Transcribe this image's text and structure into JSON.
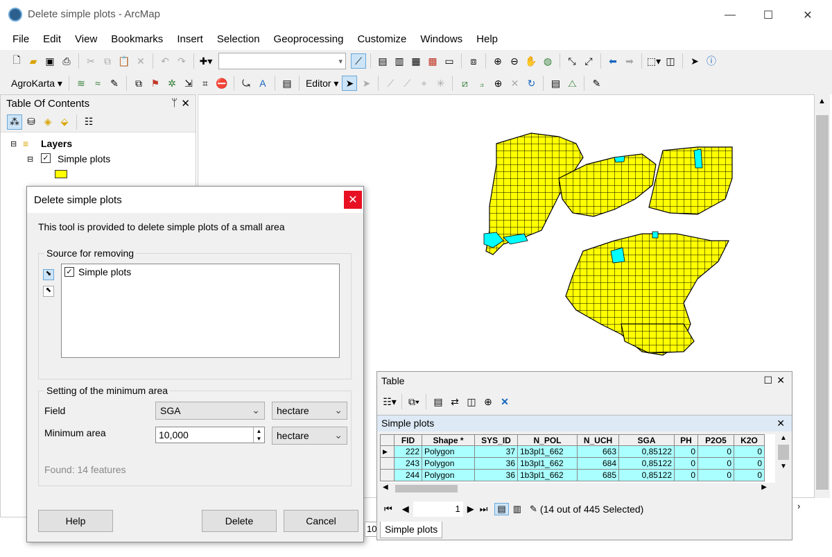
{
  "window": {
    "title": "Delete simple plots - ArcMap",
    "minimize": "—",
    "maximize": "☐",
    "close": "✕"
  },
  "menu": [
    "File",
    "Edit",
    "View",
    "Bookmarks",
    "Insert",
    "Selection",
    "Geoprocessing",
    "Customize",
    "Windows",
    "Help"
  ],
  "toolbar2": {
    "agrokarta_label": "AgroKarta ▾",
    "editor_label": "Editor ▾"
  },
  "toc": {
    "title": "Table Of Contents",
    "pin": "ᛘ",
    "close": "✕",
    "layers_label": "Layers",
    "layer_name": "Simple plots",
    "layer_color": "#ffff00"
  },
  "dialog": {
    "title": "Delete simple plots",
    "close": "✕",
    "description": "This tool is provided to delete simple plots of a small area",
    "source_group_label": "Source for removing",
    "source_item": "Simple plots",
    "min_area_group_label": "Setting of the minimum area",
    "field_label": "Field",
    "field_value": "SGA",
    "field_unit": "hectare",
    "min_area_label": "Minimum area",
    "min_area_value": "10,000",
    "min_area_unit": "hectare",
    "found_text": "Found: 14 features",
    "help_button": "Help",
    "delete_button": "Delete",
    "cancel_button": "Cancel"
  },
  "table": {
    "title": "Table",
    "tab_title": "Simple plots",
    "columns": [
      "FID",
      "Shape *",
      "SYS_ID",
      "N_POL",
      "N_UCH",
      "SGA",
      "PH",
      "P2O5",
      "K2O"
    ],
    "rows": [
      [
        "222",
        "Polygon",
        "37",
        "1b3pl1_662",
        "663",
        "0,85122",
        "0",
        "0",
        "0"
      ],
      [
        "243",
        "Polygon",
        "36",
        "1b3pl1_662",
        "684",
        "0,85122",
        "0",
        "0",
        "0"
      ],
      [
        "244",
        "Polygon",
        "36",
        "1b3pl1_662",
        "685",
        "0,85122",
        "0",
        "0",
        "0"
      ]
    ],
    "page_number": "1",
    "selection_status": "(14 out of 445 Selected)",
    "bottom_tab": "Simple plots"
  },
  "status": {
    "scale_fragment": "10"
  },
  "colors": {
    "plot_fill": "#ffff00",
    "selected_fill": "#00ffff",
    "close_red": "#e81123",
    "selected_row": "#aaffff"
  }
}
